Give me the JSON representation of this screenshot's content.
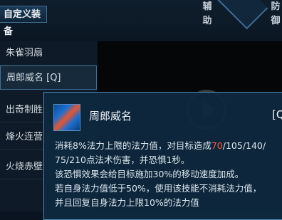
{
  "header": {
    "custom_tab": "自定义装备",
    "categories": [
      "辅助",
      "防御"
    ]
  },
  "sidebar": {
    "items": [
      {
        "label": "朱雀羽扇"
      },
      {
        "label": "周郎威名 [Q]"
      },
      {
        "label": "出奇制胜"
      },
      {
        "label": "烽火连营"
      },
      {
        "label": "火烧赤壁"
      }
    ]
  },
  "tooltip": {
    "title": "周郎威名",
    "hotkey": "[Q",
    "desc": {
      "l1_a": "消耗8%法力上限的法力值，对目标造成",
      "l1_red": "70",
      "l1_b": "/105/140/",
      "l2": "75/210点法术伤害，并恐惧1秒。",
      "l3": "该恐惧效果会给目标施加30%的移动速度加成。",
      "l4": "若自身法力值低于50%，使用该技能不消耗法力值，",
      "l5": "并且回复自身法力上限10%的法力值"
    }
  }
}
